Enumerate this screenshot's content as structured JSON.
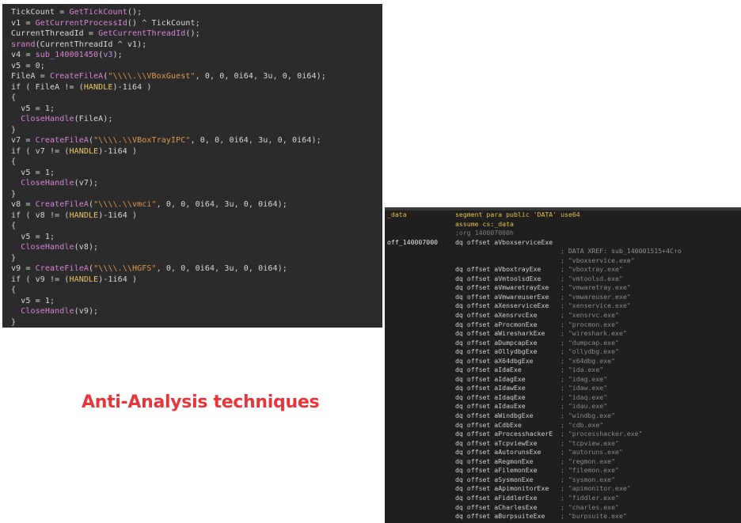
{
  "headline": "Anti-Analysis techniques",
  "code_lines": [
    "TickCount = GetTickCount();",
    "v1 = GetCurrentProcessId() ^ TickCount;",
    "CurrentThreadId = GetCurrentThreadId();",
    "srand(CurrentThreadId ^ v1);",
    "v4 = sub_140001450(v3);",
    "v5 = 0;",
    "FileA = CreateFileA(\"\\\\\\\\.\\\\VBoxGuest\", 0, 0, 0i64, 3u, 0, 0i64);",
    "if ( FileA != (HANDLE)-1i64 )",
    "{",
    "  v5 = 1;",
    "  CloseHandle(FileA);",
    "}",
    "v7 = CreateFileA(\"\\\\\\\\.\\\\VBoxTrayIPC\", 0, 0, 0i64, 3u, 0, 0i64);",
    "if ( v7 != (HANDLE)-1i64 )",
    "{",
    "  v5 = 1;",
    "  CloseHandle(v7);",
    "}",
    "v8 = CreateFileA(\"\\\\\\\\.\\\\vmci\", 0, 0, 0i64, 3u, 0, 0i64);",
    "if ( v8 != (HANDLE)-1i64 )",
    "{",
    "  v5 = 1;",
    "  CloseHandle(v8);",
    "}",
    "v9 = CreateFileA(\"\\\\\\\\.\\\\HGFS\", 0, 0, 0i64, 3u, 0, 0i64);",
    "if ( v9 != (HANDLE)-1i64 )",
    "{",
    "  v5 = 1;",
    "  CloseHandle(v9);",
    "}"
  ],
  "asm_header": [
    {
      "label": "_data",
      "instr": "segment para public 'DATA' use64",
      "cls": "seg"
    },
    {
      "label": "",
      "instr": "assume cs:_data",
      "cls": "seg"
    },
    {
      "label": "",
      "instr": ";org 140007000h",
      "cls": "dim"
    }
  ],
  "asm_first": {
    "label": "off_140007000",
    "instr": "dq offset aVboxserviceExe",
    "xref": "; DATA XREF: sub_140001515+4C↑o",
    "xref_str": "; \"vboxservice.exe\""
  },
  "asm_entries": [
    {
      "sym": "aVboxtrayExe",
      "str": "\"vboxtray.exe\""
    },
    {
      "sym": "aVmtoolsdExe",
      "str": "\"vmtoolsd.exe\""
    },
    {
      "sym": "aVmwaretrayExe",
      "str": "\"vmwaretray.exe\""
    },
    {
      "sym": "aVmwareuserExe",
      "str": "\"vmwareuser.exe\""
    },
    {
      "sym": "aXenserviceExe",
      "str": "\"xenservice.exe\""
    },
    {
      "sym": "aXensrvcExe",
      "str": "\"xensrvc.exe\""
    },
    {
      "sym": "aProcmonExe",
      "str": "\"procmon.exe\""
    },
    {
      "sym": "aWiresharkExe",
      "str": "\"wireshark.exe\""
    },
    {
      "sym": "aDumpcapExe",
      "str": "\"dumpcap.exe\""
    },
    {
      "sym": "aOllydbgExe",
      "str": "\"ollydbg.exe\""
    },
    {
      "sym": "aX64dbgExe",
      "str": "\"x64dbg.exe\""
    },
    {
      "sym": "aIdaExe",
      "str": "\"ida.exe\""
    },
    {
      "sym": "aIdagExe",
      "str": "\"idag.exe\""
    },
    {
      "sym": "aIdawExe",
      "str": "\"idaw.exe\""
    },
    {
      "sym": "aIdaqExe",
      "str": "\"idaq.exe\""
    },
    {
      "sym": "aIdauExe",
      "str": "\"idau.exe\""
    },
    {
      "sym": "aWindbgExe",
      "str": "\"windbg.exe\""
    },
    {
      "sym": "aCdbExe",
      "str": "\"cdb.exe\""
    },
    {
      "sym": "aProcesshackerE",
      "str": "\"processhacker.exe\""
    },
    {
      "sym": "aTcpviewExe",
      "str": "\"tcpview.exe\""
    },
    {
      "sym": "aAutorunsExe",
      "str": "\"autoruns.exe\""
    },
    {
      "sym": "aRegmonExe",
      "str": "\"regmon.exe\""
    },
    {
      "sym": "aFilemonExe",
      "str": "\"filemon.exe\""
    },
    {
      "sym": "aSysmonExe",
      "str": "\"sysmon.exe\""
    },
    {
      "sym": "aApimonitorExe",
      "str": "\"apimonitor.exe\""
    },
    {
      "sym": "aFiddlerExe",
      "str": "\"fiddler.exe\""
    },
    {
      "sym": "aCharlesExe",
      "str": "\"charles.exe\""
    },
    {
      "sym": "aBurpsuiteExe",
      "str": "\"burpsuite.exe\""
    }
  ],
  "colors": {
    "headline": "#e8343a",
    "code_bg": "#2b2b2b",
    "asm_bg": "#1f1f1f",
    "function": "#d883d6",
    "string": "#e0984e",
    "type": "#ecc46a",
    "segment": "#e2c14a"
  }
}
